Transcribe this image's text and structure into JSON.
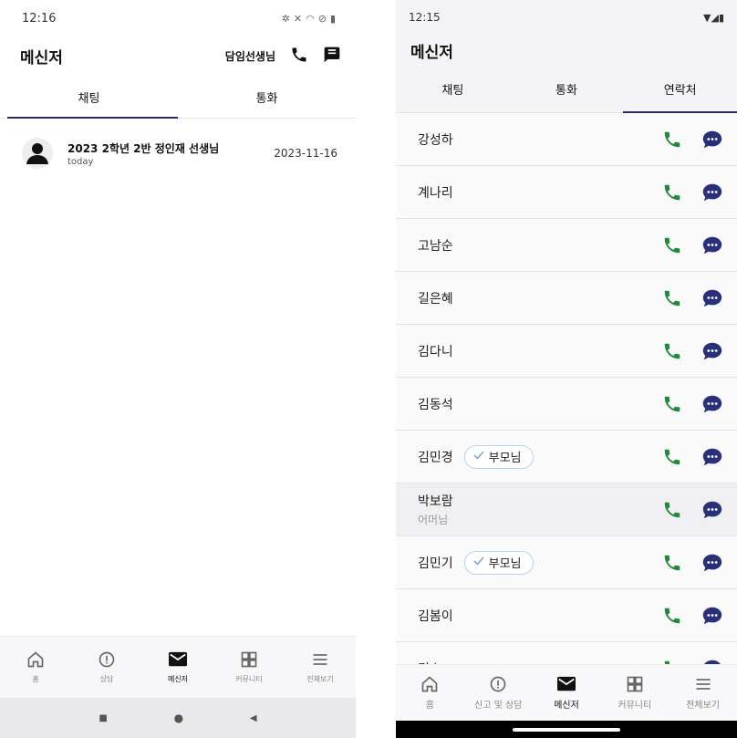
{
  "left": {
    "status": {
      "time": "12:16"
    },
    "header": {
      "title": "메신저",
      "teacher_label": "담임선생님"
    },
    "tabs": [
      {
        "label": "채팅",
        "active": true
      },
      {
        "label": "통화",
        "active": false
      }
    ],
    "chats": [
      {
        "name": "2023 2학년 2반 정인재 선생님",
        "subtitle": "today",
        "date": "2023-11-16"
      }
    ],
    "nav": [
      {
        "label": "홈",
        "icon": "home-icon"
      },
      {
        "label": "상담",
        "icon": "alert-icon"
      },
      {
        "label": "메신저",
        "icon": "mail-icon",
        "active": true
      },
      {
        "label": "커뮤니티",
        "icon": "grid-icon"
      },
      {
        "label": "전체보기",
        "icon": "menu-icon"
      }
    ]
  },
  "right": {
    "status": {
      "time": "12:15"
    },
    "header": {
      "title": "메신저"
    },
    "tabs": [
      {
        "label": "채팅",
        "active": false
      },
      {
        "label": "통화",
        "active": false
      },
      {
        "label": "연락처",
        "active": true
      }
    ],
    "contacts": [
      {
        "name": "강성하"
      },
      {
        "name": "계나리"
      },
      {
        "name": "고남순"
      },
      {
        "name": "길은혜"
      },
      {
        "name": "김다니"
      },
      {
        "name": "김동석"
      },
      {
        "name": "김민경",
        "badge": "부모님"
      },
      {
        "name": "박보람",
        "sub": "어머님"
      },
      {
        "name": "김민기",
        "badge": "부모님"
      },
      {
        "name": "김봄이"
      },
      {
        "name": "김소"
      }
    ],
    "nav": [
      {
        "label": "홈",
        "icon": "home-icon"
      },
      {
        "label": "신고 및 상담",
        "icon": "alert-icon"
      },
      {
        "label": "메신저",
        "icon": "mail-icon",
        "active": true
      },
      {
        "label": "커뮤니티",
        "icon": "grid-icon"
      },
      {
        "label": "전체보기",
        "icon": "menu-icon"
      }
    ]
  },
  "colors": {
    "accent": "#2b2a66",
    "call_green": "#1e8a3c",
    "chat_navy": "#2a2f7a"
  }
}
